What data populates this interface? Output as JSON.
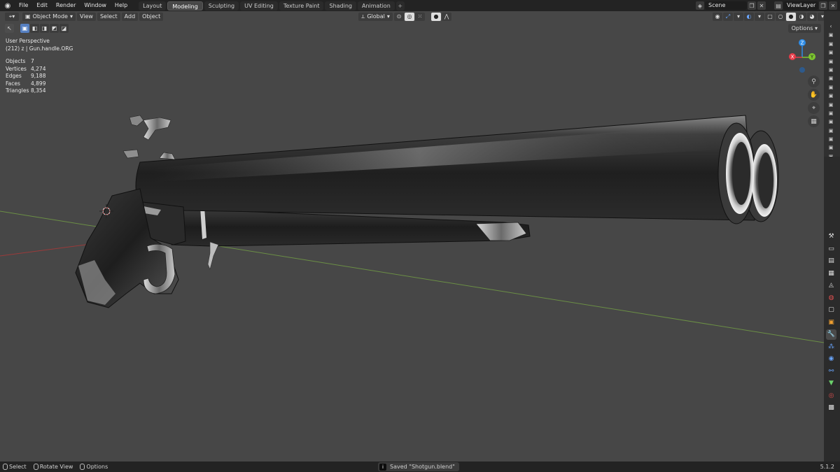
{
  "menus": [
    "File",
    "Edit",
    "Render",
    "Window",
    "Help"
  ],
  "workspaces": [
    "Layout",
    "Modeling",
    "Sculpting",
    "UV Editing",
    "Texture Paint",
    "Shading",
    "Animation"
  ],
  "active_workspace": "Modeling",
  "scene": "Scene",
  "view_layer": "ViewLayer",
  "viewport_header": {
    "mode": "Object Mode",
    "menus": [
      "View",
      "Select",
      "Add",
      "Object"
    ],
    "transform_orientation": "Global",
    "options_label": "Options"
  },
  "overlay": {
    "view_name": "User Perspective",
    "active_object": "(212) z | Gun.handle.ORG",
    "stats": [
      {
        "label": "Objects",
        "value": "7"
      },
      {
        "label": "Vertices",
        "value": "4,274"
      },
      {
        "label": "Edges",
        "value": "9,188"
      },
      {
        "label": "Faces",
        "value": "4,899"
      },
      {
        "label": "Triangles",
        "value": "8,354"
      }
    ]
  },
  "gizmo": {
    "z": "Z",
    "y": "Y",
    "x": "X"
  },
  "status": {
    "hints": [
      "Select",
      "Rotate View",
      "Options"
    ],
    "message": "Saved \"Shotgun.blend\"",
    "version": "5.1.2"
  },
  "colors": {
    "accent": "#5680c2",
    "viewport_bg": "#474747",
    "x_axis": "#e63b48",
    "y_axis": "#7cc62f",
    "z_axis": "#2e8ce6"
  }
}
